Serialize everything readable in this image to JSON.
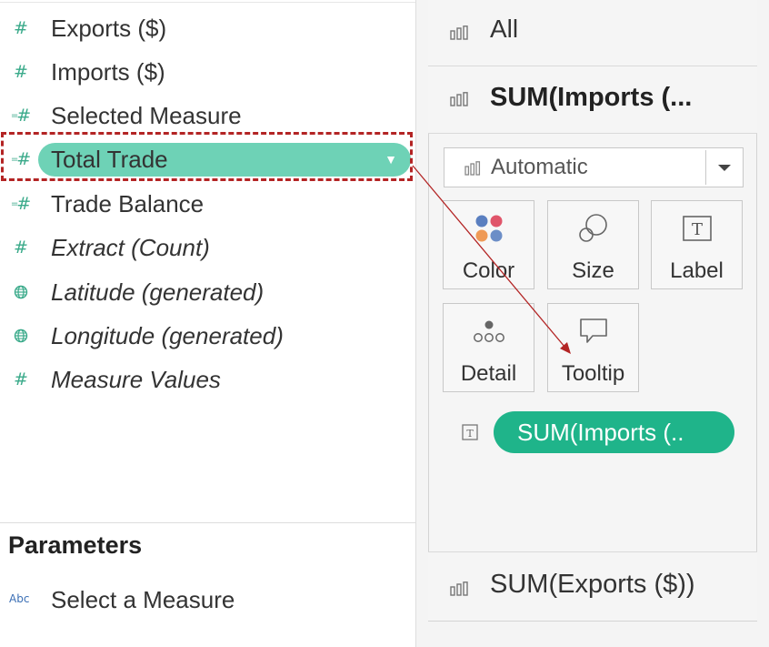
{
  "data_pane": {
    "fields": [
      {
        "name": "Exports ($)",
        "icon": "measure-number-icon",
        "italic": false
      },
      {
        "name": "Imports ($)",
        "icon": "measure-number-icon",
        "italic": false
      },
      {
        "name": "Selected Measure",
        "icon": "calculated-measure-icon",
        "italic": false
      },
      {
        "name": "Total Trade",
        "icon": "calculated-measure-icon",
        "italic": false,
        "selected": true
      },
      {
        "name": "Trade Balance",
        "icon": "calculated-measure-icon",
        "italic": false
      },
      {
        "name": "Extract (Count)",
        "icon": "measure-number-icon",
        "italic": true
      },
      {
        "name": "Latitude (generated)",
        "icon": "globe-icon",
        "italic": true
      },
      {
        "name": "Longitude (generated)",
        "icon": "globe-icon",
        "italic": true
      },
      {
        "name": "Measure Values",
        "icon": "measure-number-icon",
        "italic": true
      }
    ],
    "parameters": {
      "title": "Parameters",
      "items": [
        {
          "name": "Select a Measure",
          "type_badge": "Abc"
        }
      ]
    }
  },
  "marks_card": {
    "tabs": {
      "all": "All",
      "sum_imports": "SUM(Imports (...",
      "sum_exports": "SUM(Exports ($))"
    },
    "mark_type": "Automatic",
    "buttons": {
      "color": "Color",
      "size": "Size",
      "label": "Label",
      "detail": "Detail",
      "tooltip": "Tooltip"
    },
    "pill": "SUM(Imports (..",
    "pill_encoding_icon": "text-encoding-icon"
  },
  "colors": {
    "measure_green": "#3aaa8a",
    "pill_light": "#6ed2b6",
    "pill_dark": "#1fb48a",
    "annotation_red": "#b32424"
  }
}
